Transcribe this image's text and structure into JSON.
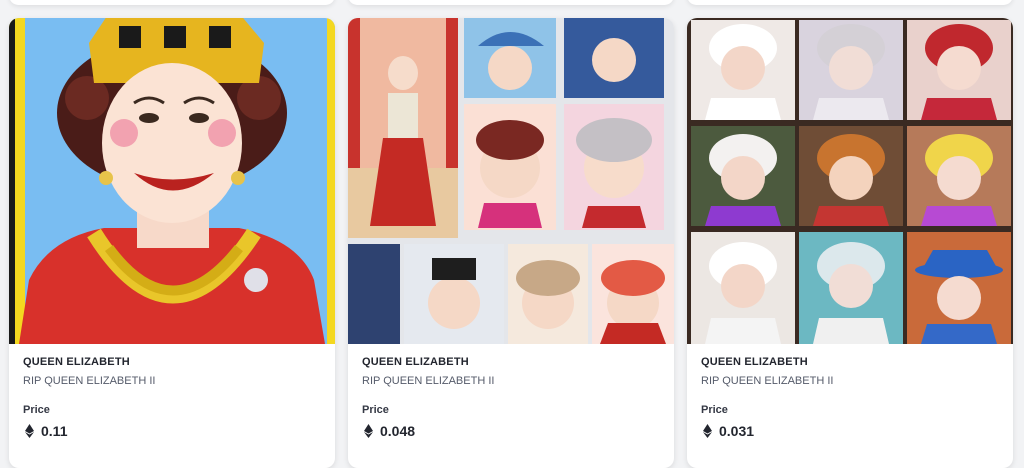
{
  "cards": [
    {
      "title": "QUEEN ELIZABETH",
      "collection": "RIP QUEEN ELIZABETH II",
      "price_label": "Price",
      "price": "0.11",
      "currency_icon": "ethereum-icon"
    },
    {
      "title": "QUEEN ELIZABETH",
      "collection": "RIP QUEEN ELIZABETH II",
      "price_label": "Price",
      "price": "0.048",
      "currency_icon": "ethereum-icon"
    },
    {
      "title": "QUEEN ELIZABETH",
      "collection": "RIP QUEEN ELIZABETH II",
      "price_label": "Price",
      "price": "0.031",
      "currency_icon": "ethereum-icon"
    }
  ],
  "colors": {
    "page_background": "#f2f3f5",
    "card_background": "#ffffff",
    "title_text": "#23262f",
    "subtitle_text": "#555b6a"
  }
}
